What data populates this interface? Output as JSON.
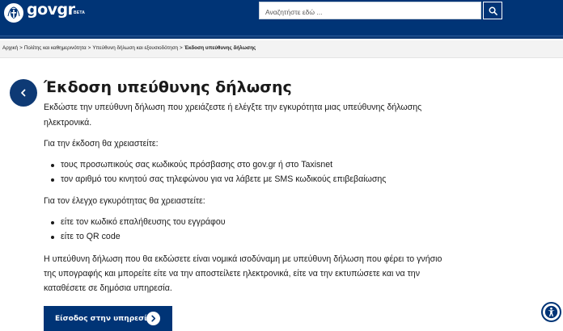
{
  "header": {
    "logo_text": "govgr",
    "beta_label": "BETA",
    "search": {
      "placeholder": "Αναζητήστε εδώ ...",
      "value": ""
    },
    "colors": {
      "brand": "#003476",
      "background": "#ffffff"
    }
  },
  "breadcrumb": {
    "items": [
      "Αρχική",
      "Πολίτης και καθημερινότητα",
      "Υπεύθυνη δήλωση και εξουσιοδότηση"
    ],
    "current": "Έκδοση υπεύθυνης δήλωσης",
    "separator": ">"
  },
  "main": {
    "title": "Έκδοση υπεύθυνης δήλωσης",
    "intro_lines": [
      "Εκδώστε την υπεύθυνη δήλωση που χρειάζεστε ή ελέγξτε την εγκυρότητα μιας υπεύθυνης δήλωσης",
      "ηλεκτρονικά."
    ],
    "issue_heading": "Για την έκδοση θα χρειαστείτε:",
    "issue_items": [
      "τους προσωπικούς σας κωδικούς πρόσβασης στο gov.gr ή στο Taxisnet",
      "τον αριθμό του κινητού σας τηλεφώνου για να λάβετε με SMS κωδικούς επιβεβαίωσης"
    ],
    "check_heading": "Για τον έλεγχο εγκυρότητας θα χρειαστείτε:",
    "check_items": [
      "είτε τον κωδικό επαλήθευσης του εγγράφου",
      "είτε το QR code"
    ],
    "closing_lines": [
      "Η υπεύθυνη δήλωση που θα εκδώσετε είναι νομικά ισοδύναμη με υπεύθυνη δήλωση που φέρει το γνήσιο",
      "της υπογραφής και μπορείτε είτε να την αποστείλετε ηλεκτρονικά, είτε να την εκτυπώσετε και να την",
      "καταθέσετε σε δημόσια υπηρεσία."
    ],
    "cta_label": "Είσοδος στην υπηρεσία"
  },
  "icons": {
    "emblem": "greek-coat-of-arms-icon",
    "search": "search-icon",
    "back": "chevron-left-icon",
    "cta_arrow": "chevron-right-icon",
    "accessibility": "accessibility-icon"
  }
}
